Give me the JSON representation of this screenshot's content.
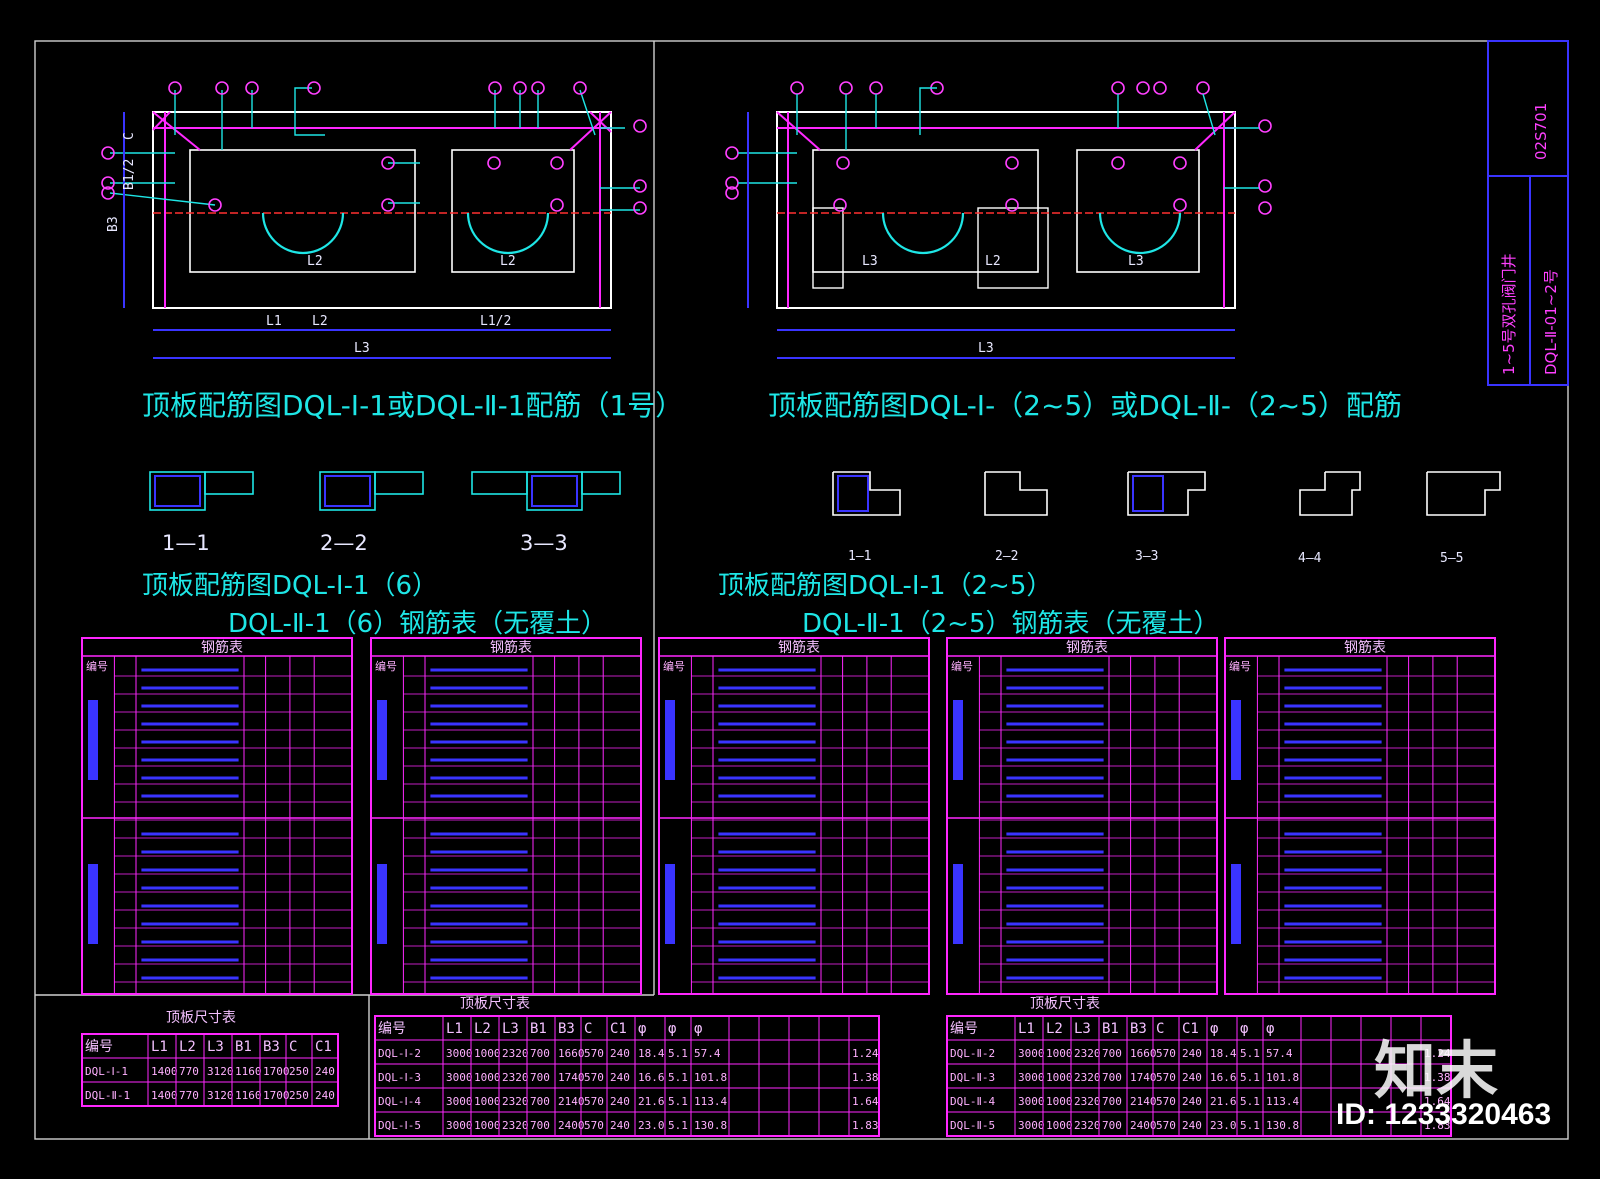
{
  "colors": {
    "background": "#000000",
    "frame": "#cfcfcf",
    "magenta": "#ff28ff",
    "cyan": "#1ee6e6",
    "blue": "#3a34ff",
    "white": "#ffffff",
    "red": "#ff3030"
  },
  "title_block": {
    "drawing_no": "02S701",
    "name": "1~5号双孔阀门井",
    "sheet": "DQL-Ⅱ-01~2号"
  },
  "left_plan": {
    "dims": {
      "C": "C",
      "B12": "B1/2",
      "B3": "B3",
      "L1": "L1",
      "L2": "L2",
      "L12": "L1/2",
      "L3": "L3"
    },
    "inner_labels": [
      "L2",
      "L2"
    ]
  },
  "right_plan": {
    "dims": {
      "L3": "L3"
    },
    "inner_labels": [
      "L3",
      "L2",
      "L3"
    ]
  },
  "titles": {
    "plan_left": "顶板配筋图DQL-Ⅰ-1或DQL-Ⅱ-1配筋（1号）",
    "plan_right": "顶板配筋图DQL-Ⅰ-（2~5）或DQL-Ⅱ-（2~5）配筋",
    "schedule_left_1": "顶板配筋图DQL-Ⅰ-1（6）",
    "schedule_left_2": "DQL-Ⅱ-1（6）钢筋表（无覆土）",
    "schedule_right_1": "顶板配筋图DQL-Ⅰ-1（2~5）",
    "schedule_right_2": "DQL-Ⅱ-1（2~5）钢筋表（无覆土）"
  },
  "sections_left": [
    "1—1",
    "2—2",
    "3—3"
  ],
  "sections_right": [
    "1—1",
    "2—2",
    "3—3",
    "4—4",
    "5—5"
  ],
  "dim_table_left": {
    "caption": "顶板尺寸表",
    "headers": [
      "编号",
      "L1",
      "L2",
      "L3",
      "B1",
      "B3",
      "C",
      "C1"
    ],
    "rows": [
      [
        "DQL-Ⅰ-1",
        "1400",
        "770",
        "3120",
        "1160",
        "1700",
        "250",
        "240"
      ],
      [
        "DQL-Ⅱ-1",
        "1400",
        "770",
        "3120",
        "1160",
        "1700",
        "250",
        "240"
      ]
    ]
  },
  "dim_table_mid": {
    "caption": "顶板尺寸表",
    "headers": [
      "编号",
      "L1",
      "L2",
      "L3",
      "B1",
      "B3",
      "C",
      "C1",
      "φ",
      "φ",
      "φ",
      "",
      "",
      "",
      "",
      ""
    ],
    "rows": [
      [
        "DQL-Ⅰ-2",
        "3000",
        "1000",
        "2320",
        "700",
        "1660",
        "570",
        "240",
        "18.4",
        "5.1",
        "57.4",
        "",
        "",
        "",
        "",
        "1.24"
      ],
      [
        "DQL-Ⅰ-3",
        "3000",
        "1000",
        "2320",
        "700",
        "1740",
        "570",
        "240",
        "16.6",
        "5.1",
        "101.8",
        "",
        "",
        "",
        "",
        "1.38"
      ],
      [
        "DQL-Ⅰ-4",
        "3000",
        "1000",
        "2320",
        "700",
        "2140",
        "570",
        "240",
        "21.6",
        "5.1",
        "113.4",
        "",
        "",
        "",
        "",
        "1.64"
      ],
      [
        "DQL-Ⅰ-5",
        "3000",
        "1000",
        "2320",
        "700",
        "2400",
        "570",
        "240",
        "23.0",
        "5.1",
        "130.8",
        "",
        "",
        "",
        "",
        "1.83"
      ]
    ]
  },
  "dim_table_right": {
    "caption": "顶板尺寸表",
    "headers": [
      "编号",
      "L1",
      "L2",
      "L3",
      "B1",
      "B3",
      "C",
      "C1",
      "φ",
      "φ",
      "φ",
      "",
      "",
      "",
      "",
      ""
    ],
    "rows": [
      [
        "DQL-Ⅱ-2",
        "3000",
        "1000",
        "2320",
        "700",
        "1660",
        "570",
        "240",
        "18.4",
        "5.1",
        "57.4",
        "",
        "",
        "",
        "",
        "1.24"
      ],
      [
        "DQL-Ⅱ-3",
        "3000",
        "1000",
        "2320",
        "700",
        "1740",
        "570",
        "240",
        "16.6",
        "5.1",
        "101.8",
        "",
        "",
        "",
        "",
        "1.38"
      ],
      [
        "DQL-Ⅱ-4",
        "3000",
        "1000",
        "2320",
        "700",
        "2140",
        "570",
        "240",
        "21.6",
        "5.1",
        "113.4",
        "",
        "",
        "",
        "",
        "1.64"
      ],
      [
        "DQL-Ⅱ-5",
        "3000",
        "1000",
        "2320",
        "700",
        "2400",
        "570",
        "240",
        "23.0",
        "5.1",
        "130.8",
        "",
        "",
        "",
        "",
        "1.83"
      ]
    ]
  },
  "rebar_table_header": "钢筋表",
  "rebar_table_col_head": "编号",
  "watermark": {
    "brand": "知末",
    "id": "ID: 1233320463"
  }
}
